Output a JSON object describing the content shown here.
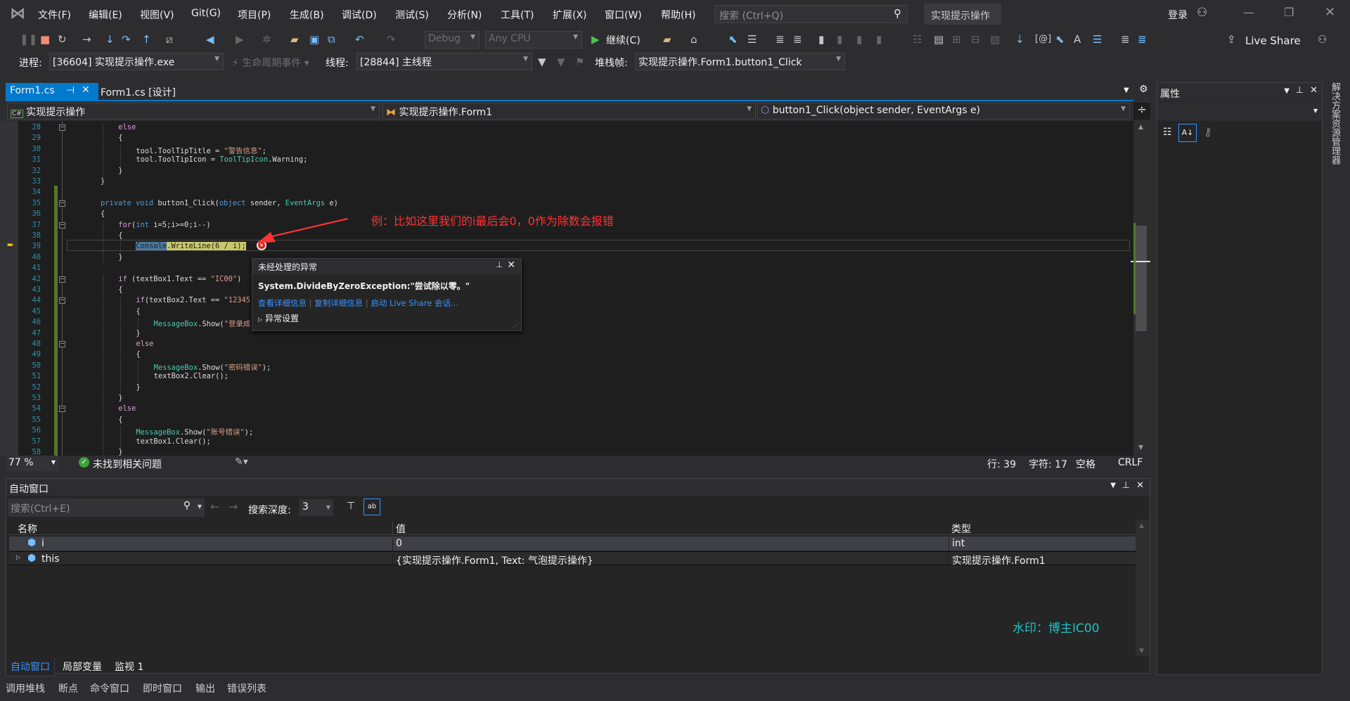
{
  "menu": [
    "文件(F)",
    "编辑(E)",
    "视图(V)",
    "Git(G)",
    "项目(P)",
    "生成(B)",
    "调试(D)",
    "测试(S)",
    "分析(N)",
    "工具(T)",
    "扩展(X)",
    "窗口(W)",
    "帮助(H)"
  ],
  "search_placeholder": "搜索 (Ctrl+Q)",
  "solution_title": "实现提示操作",
  "login": "登录",
  "toolbar": {
    "config": "Debug",
    "platform": "Any CPU",
    "continue": "继续(C)",
    "live_share": "Live Share"
  },
  "debugbar": {
    "process_label": "进程:",
    "process": "[36604] 实现提示操作.exe",
    "lifecycle": "生命周期事件",
    "thread_label": "线程:",
    "thread": "[28844] 主线程",
    "stack_label": "堆栈帧:",
    "stack": "实现提示操作.Form1.button1_Click"
  },
  "tabs": [
    {
      "label": "Form1.cs",
      "active": true
    },
    {
      "label": "Form1.cs [设计]",
      "active": false
    }
  ],
  "nav": {
    "project": "实现提示操作",
    "class": "实现提示操作.Form1",
    "member": "button1_Click(object sender, EventArgs e)"
  },
  "code": [
    {
      "n": 28,
      "i": 1,
      "t": [
        [
          "else",
          "ctl"
        ]
      ]
    },
    {
      "n": 29,
      "i": 1,
      "t": [
        [
          "{",
          "txt"
        ]
      ]
    },
    {
      "n": 30,
      "i": 2,
      "t": [
        [
          "tool.ToolTipTitle = ",
          "txt"
        ],
        [
          "\"警告信息\"",
          "str"
        ],
        [
          ";",
          "txt"
        ]
      ]
    },
    {
      "n": 31,
      "i": 2,
      "t": [
        [
          "tool.ToolTipIcon = ",
          "txt"
        ],
        [
          "ToolTipIcon",
          "ty"
        ],
        [
          ".Warning;",
          "txt"
        ]
      ]
    },
    {
      "n": 32,
      "i": 1,
      "t": [
        [
          "}",
          "txt"
        ]
      ]
    },
    {
      "n": 33,
      "i": 0,
      "t": [
        [
          "}",
          "txt"
        ]
      ]
    },
    {
      "n": 34,
      "i": 0,
      "t": []
    },
    {
      "n": 35,
      "i": 0,
      "t": [
        [
          "private void ",
          "kw"
        ],
        [
          "button1_Click(",
          "txt"
        ],
        [
          "object",
          "kw"
        ],
        [
          " sender, ",
          "txt"
        ],
        [
          "EventArgs",
          "ty"
        ],
        [
          " e)",
          "txt"
        ]
      ]
    },
    {
      "n": 36,
      "i": 0,
      "t": [
        [
          "{",
          "txt"
        ]
      ]
    },
    {
      "n": 37,
      "i": 1,
      "t": [
        [
          "for",
          "ctl"
        ],
        [
          "(",
          "txt"
        ],
        [
          "int",
          "kw"
        ],
        [
          " i=5;i>=0;i--)",
          "txt"
        ]
      ]
    },
    {
      "n": 38,
      "i": 1,
      "t": [
        [
          "{",
          "txt"
        ]
      ]
    },
    {
      "n": 39,
      "i": 2,
      "t": [
        [
          "Console",
          "sel"
        ],
        [
          ".WriteLine(6 / i);",
          "hl"
        ]
      ]
    },
    {
      "n": 40,
      "i": 1,
      "t": [
        [
          "}",
          "txt"
        ]
      ]
    },
    {
      "n": 41,
      "i": 0,
      "t": []
    },
    {
      "n": 42,
      "i": 1,
      "t": [
        [
          "if",
          "ctl"
        ],
        [
          " (textBox1.Text == ",
          "txt"
        ],
        [
          "\"IC00\"",
          "str"
        ],
        [
          ")",
          "txt"
        ]
      ]
    },
    {
      "n": 43,
      "i": 1,
      "t": [
        [
          "{",
          "txt"
        ]
      ]
    },
    {
      "n": 44,
      "i": 2,
      "t": [
        [
          "if",
          "ctl"
        ],
        [
          "(textBox2.Text == ",
          "txt"
        ],
        [
          "\"12345",
          "str"
        ]
      ]
    },
    {
      "n": 45,
      "i": 2,
      "t": [
        [
          "{",
          "txt"
        ]
      ]
    },
    {
      "n": 46,
      "i": 3,
      "t": [
        [
          "MessageBox",
          "ty"
        ],
        [
          ".Show(",
          "txt"
        ],
        [
          "\"登录成",
          "str"
        ]
      ]
    },
    {
      "n": 47,
      "i": 2,
      "t": [
        [
          "}",
          "txt"
        ]
      ]
    },
    {
      "n": 48,
      "i": 2,
      "t": [
        [
          "else",
          "ctl"
        ]
      ]
    },
    {
      "n": 49,
      "i": 2,
      "t": [
        [
          "{",
          "txt"
        ]
      ]
    },
    {
      "n": 50,
      "i": 3,
      "t": [
        [
          "MessageBox",
          "ty"
        ],
        [
          ".Show(",
          "txt"
        ],
        [
          "\"密码错误\"",
          "str"
        ],
        [
          ");",
          "txt"
        ]
      ]
    },
    {
      "n": 51,
      "i": 3,
      "t": [
        [
          "textBox2.Clear();",
          "txt"
        ]
      ]
    },
    {
      "n": 52,
      "i": 2,
      "t": [
        [
          "}",
          "txt"
        ]
      ]
    },
    {
      "n": 53,
      "i": 1,
      "t": [
        [
          "}",
          "txt"
        ]
      ]
    },
    {
      "n": 54,
      "i": 1,
      "t": [
        [
          "else",
          "ctl"
        ]
      ]
    },
    {
      "n": 55,
      "i": 1,
      "t": [
        [
          "{",
          "txt"
        ]
      ]
    },
    {
      "n": 56,
      "i": 2,
      "t": [
        [
          "MessageBox",
          "ty"
        ],
        [
          ".Show(",
          "txt"
        ],
        [
          "\"账号错误\"",
          "str"
        ],
        [
          ");",
          "txt"
        ]
      ]
    },
    {
      "n": 57,
      "i": 2,
      "t": [
        [
          "textBox1.Clear();",
          "txt"
        ]
      ]
    },
    {
      "n": 58,
      "i": 1,
      "t": [
        [
          "}",
          "txt"
        ]
      ]
    }
  ],
  "annotation": "例：比如这里我们的i最后会0，0作为除数会报错",
  "exception": {
    "title": "未经处理的异常",
    "message": "System.DivideByZeroException:\"尝试除以零。\"",
    "links": [
      "查看详细信息",
      "复制详细信息",
      "启动 Live Share 会话..."
    ],
    "settings": "异常设置"
  },
  "status": {
    "zoom": "77 %",
    "issues": "未找到相关问题",
    "line": "行: 39",
    "char": "字符: 17",
    "spaces": "空格",
    "eol": "CRLF"
  },
  "autos": {
    "title": "自动窗口",
    "search_placeholder": "搜索(Ctrl+E)",
    "depth_label": "搜索深度:",
    "depth": "3",
    "columns": [
      "名称",
      "值",
      "类型"
    ],
    "rows": [
      {
        "name": "i",
        "value": "0",
        "type": "int",
        "expandable": false
      },
      {
        "name": "this",
        "value": "{实现提示操作.Form1, Text: 气泡提示操作}",
        "type": "实现提示操作.Form1",
        "expandable": true
      }
    ],
    "tabs": [
      "自动窗口",
      "局部变量",
      "监视 1"
    ]
  },
  "bottom_tabs": [
    "调用堆栈",
    "断点",
    "命令窗口",
    "即时窗口",
    "输出",
    "错误列表"
  ],
  "properties": {
    "title": "属性"
  },
  "solution_explorer": "解决方案资源管理器",
  "watermark": "水印：博主IC00",
  "colors": {
    "accent": "#007acc",
    "annotation": "#ff3333",
    "watermark": "#1fc1c1"
  }
}
